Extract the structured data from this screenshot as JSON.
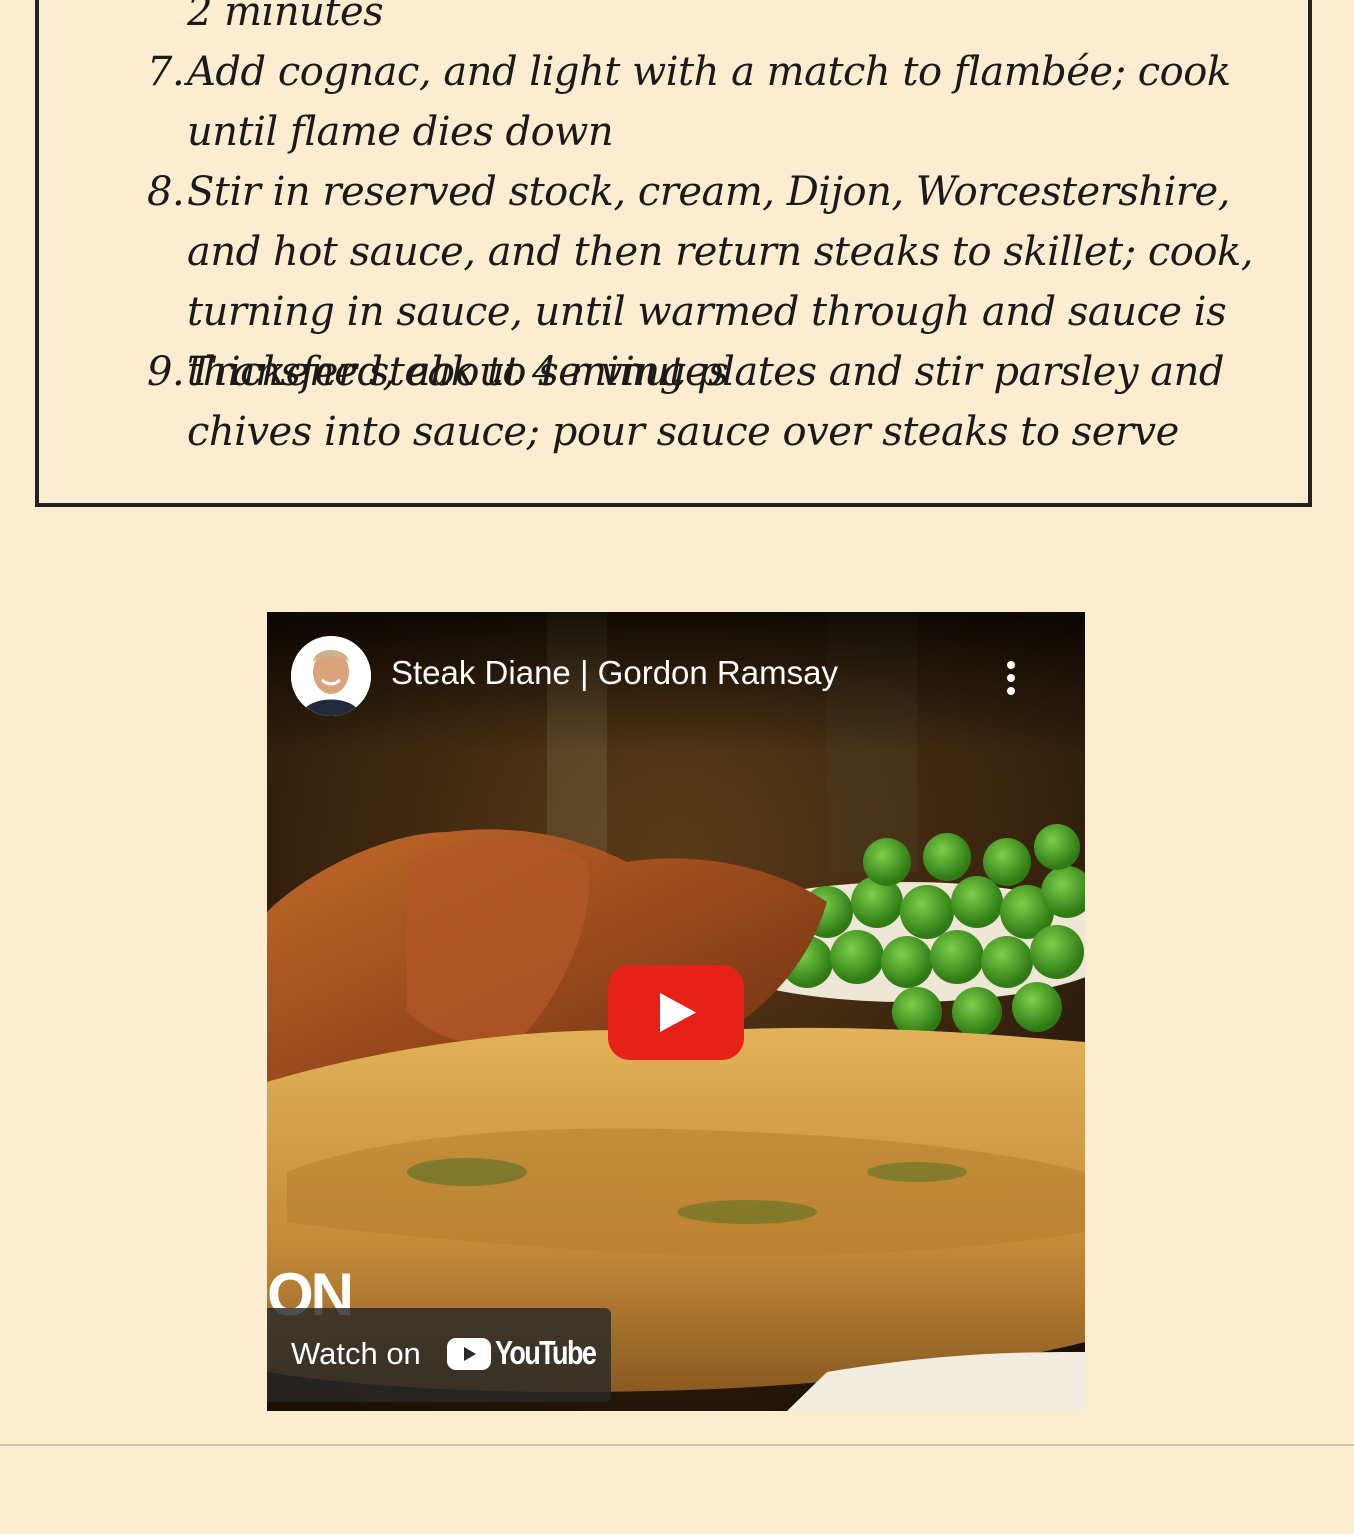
{
  "recipe": {
    "continued_text": "2 minutes",
    "steps": [
      {
        "num": "7.",
        "text": "Add cognac, and light with a match to flambée; cook until flame dies down"
      },
      {
        "num": "8.",
        "text": "Stir in reserved stock, cream, Dijon, Worcestershire, and hot sauce, and then return steaks to skillet; cook, turning in sauce, until warmed through and sauce is thickened, about 4 minutes"
      },
      {
        "num": "9.",
        "text": "Transfer steak to serving plates and stir parsley and chives into sauce; pour sauce over steaks to serve"
      }
    ]
  },
  "video": {
    "title": "Steak Diane | Gordon Ramsay",
    "watch_label": "Watch on",
    "youtube_word": "YouTube",
    "brand_fragment": "ON",
    "icons": {
      "avatar": "chef-avatar",
      "more": "more-vertical-icon",
      "play": "play-icon",
      "youtube": "youtube-logo-icon"
    },
    "colors": {
      "play_red": "#e62117",
      "peas": "#3d8a1e",
      "sauce": "#d7a24a"
    }
  }
}
